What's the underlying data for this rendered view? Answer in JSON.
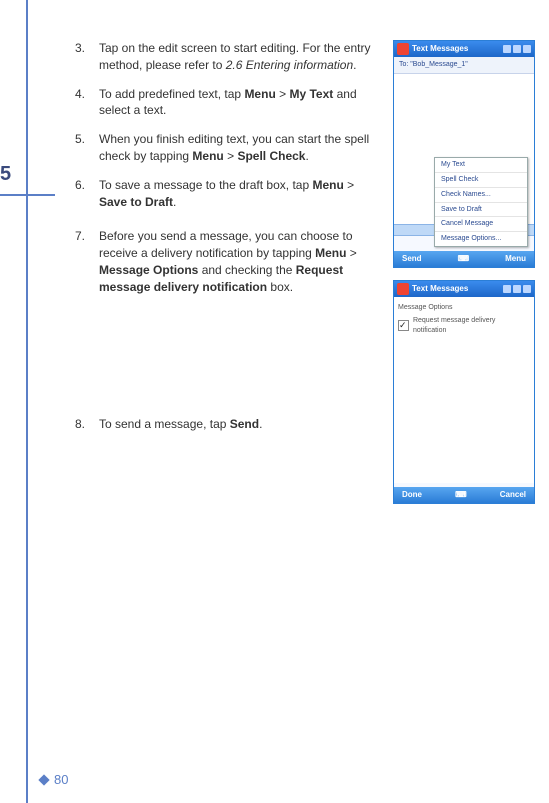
{
  "steps": [
    {
      "num": "3.",
      "html": "Tap on the edit screen to start editing. For the entry method, please refer to <em>2.6 Entering information</em>."
    },
    {
      "num": "4.",
      "html": "To add predefined text, tap <b>Menu</b> > <b>My Text</b> and select a text."
    },
    {
      "num": "5.",
      "html": "When you finish editing text, you can start the spell check by tapping <b>Menu</b> > <b>Spell Check</b>."
    },
    {
      "num": "6.",
      "html": "To save a message to the draft box, tap <b>Menu</b> > <b>Save to Draft</b>."
    },
    {
      "num": "7.",
      "html": "Before you send a message, you can choose to receive a delivery notification by tapping <b>Menu</b> > <b>Message Options</b> and checking the <b>Request message delivery notification</b> box."
    },
    {
      "num": "8.",
      "html": "To send a message, tap <b>Send</b>."
    }
  ],
  "shot1": {
    "title": "Text Messages",
    "toolbar": "To:  \"Bob_Message_1\"",
    "menu": [
      "My Text",
      "Spell Check",
      "Check Names...",
      "Save to Draft",
      "Cancel Message",
      "Message Options..."
    ],
    "left_soft": "Send",
    "right_soft": "Menu"
  },
  "shot2": {
    "title": "Text Messages",
    "opt_label": "Message Options",
    "chk_label": "Request message delivery notification",
    "left_soft": "Done",
    "right_soft": "Cancel"
  },
  "page_number": "80"
}
